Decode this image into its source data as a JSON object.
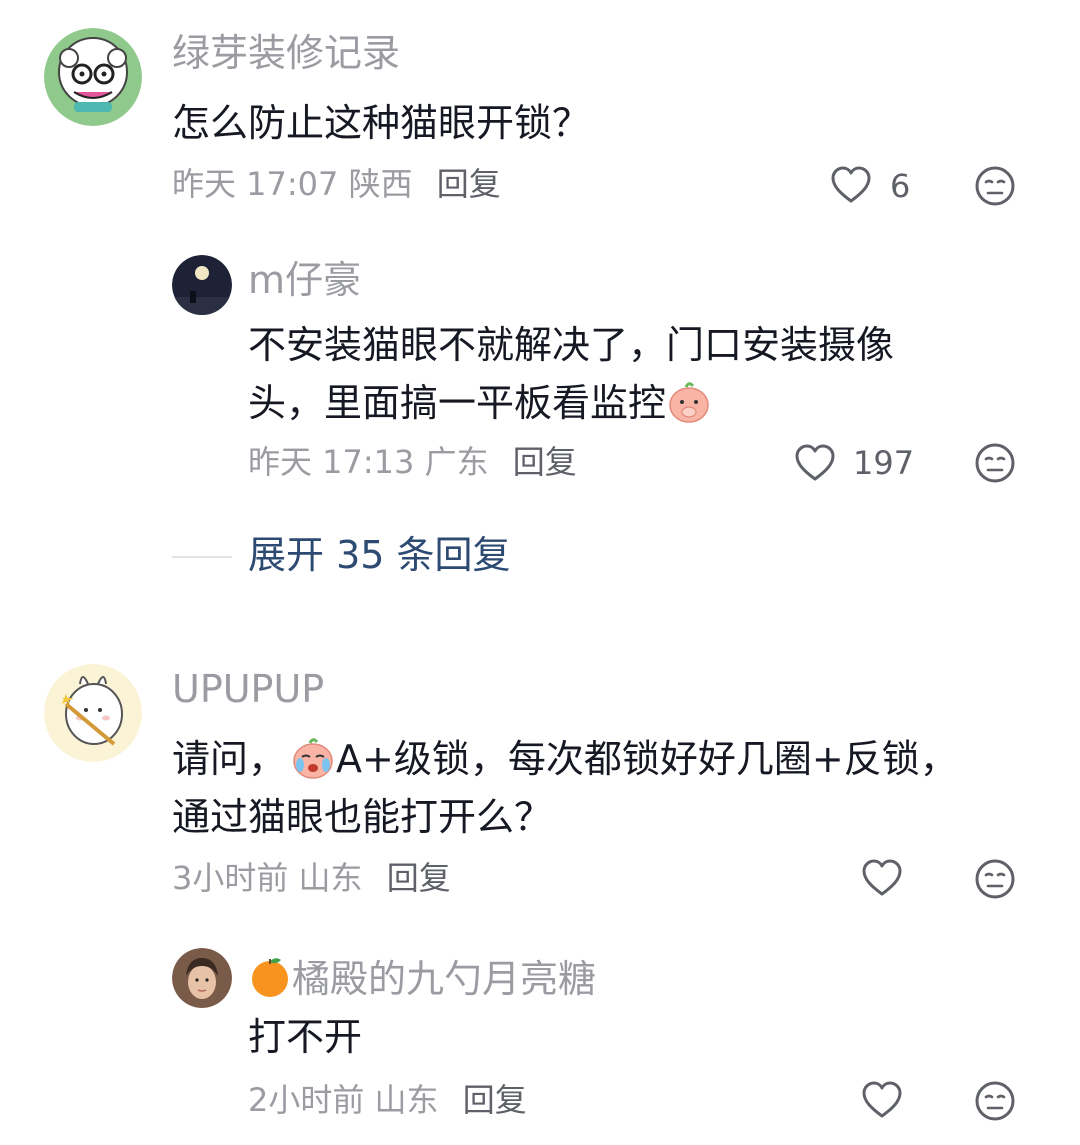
{
  "comments": [
    {
      "username": "绿芽装修记录",
      "text_lines": [
        "怎么防止这种猫眼开锁？"
      ],
      "time": "昨天 17:07",
      "location": "陕西",
      "reply_label": "回复",
      "likes": "6"
    },
    {
      "username": "m仔豪",
      "text_lines": [
        "不安装猫眼不就解决了，门口安装摄像",
        "头，里面搞一平板看监控"
      ],
      "time": "昨天 17:13",
      "location": "广东",
      "reply_label": "回复",
      "likes": "197"
    },
    {
      "username": "UPUPUP",
      "text_lines": [
        "请问，",
        "A+级锁，每次都锁好好几圈+反锁，",
        "通过猫眼也能打开么？"
      ],
      "time": "3小时前",
      "location": "山东",
      "reply_label": "回复",
      "likes": ""
    },
    {
      "username_emoji": "🍊",
      "username": "橘殿的九勺月亮糖",
      "text_lines": [
        "打不开"
      ],
      "time": "2小时前",
      "location": "山东",
      "reply_label": "回复",
      "likes": ""
    }
  ],
  "expand_replies": "展开 35 条回复",
  "icons": {
    "like": "heart-outline-icon",
    "dislike": "meh-face-icon"
  }
}
